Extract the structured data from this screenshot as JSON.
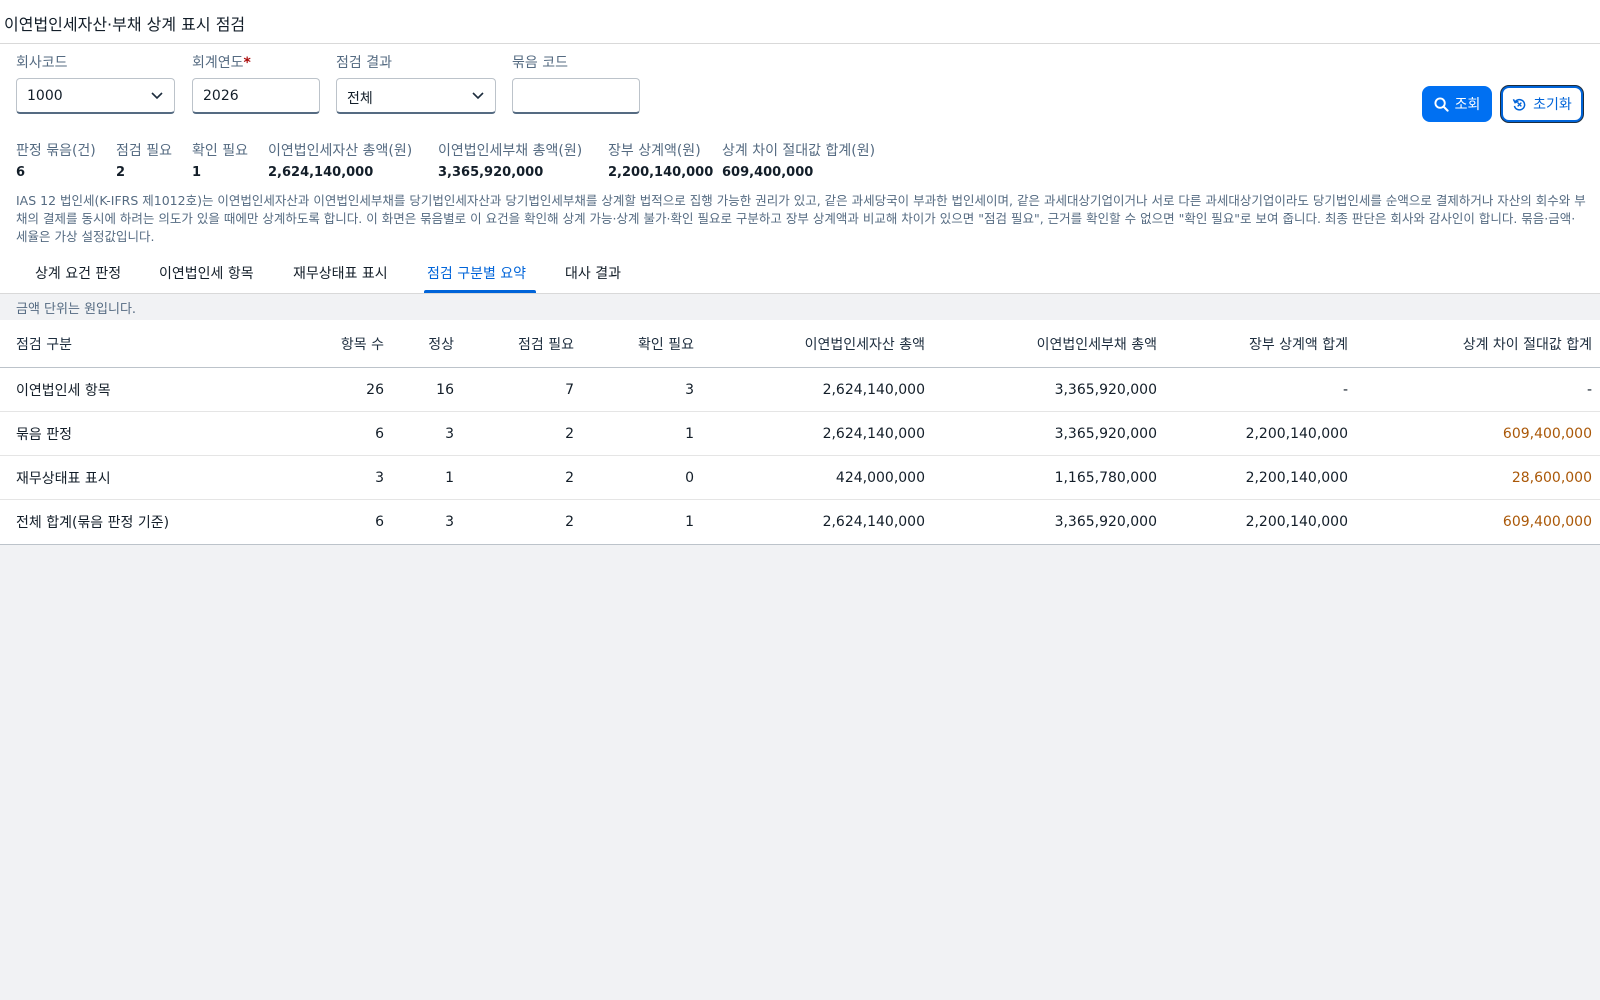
{
  "page": {
    "title": "이연법인세자산·부채 상계 표시 점검"
  },
  "filters": {
    "company_code": {
      "label": "회사코드",
      "value": "1000"
    },
    "fiscal_year": {
      "label": "회계연도",
      "required_mark": "*",
      "value": "2026"
    },
    "check_result": {
      "label": "점검 결과",
      "value": "전체"
    },
    "group_code": {
      "label": "묶음 코드",
      "value": ""
    }
  },
  "actions": {
    "search_label": "조회",
    "reset_label": "초기화"
  },
  "kpis": [
    {
      "label": "판정 묶음(건)",
      "value": "6"
    },
    {
      "label": "점검 필요",
      "value": "2"
    },
    {
      "label": "확인 필요",
      "value": "1"
    },
    {
      "label": "이연법인세자산 총액(원)",
      "value": "2,624,140,000"
    },
    {
      "label": "이연법인세부채 총액(원)",
      "value": "3,365,920,000"
    },
    {
      "label": "장부 상계액(원)",
      "value": "2,200,140,000"
    },
    {
      "label": "상계 차이 절대값 합계(원)",
      "value": "609,400,000"
    }
  ],
  "note": "IAS 12 법인세(K-IFRS 제1012호)는 이연법인세자산과 이연법인세부채를 당기법인세자산과 당기법인세부채를 상계할 법적으로 집행 가능한 권리가 있고, 같은 과세당국이 부과한 법인세이며, 같은 과세대상기업이거나 서로 다른 과세대상기업이라도 당기법인세를 순액으로 결제하거나 자산의 회수와 부채의 결제를 동시에 하려는 의도가 있을 때에만 상계하도록 합니다. 이 화면은 묶음별로 이 요건을 확인해 상계 가능·상계 불가·확인 필요로 구분하고 장부 상계액과 비교해 차이가 있으면 \"점검 필요\", 근거를 확인할 수 없으면 \"확인 필요\"로 보여 줍니다. 최종 판단은 회사와 감사인이 합니다. 묶음·금액·세율은 가상 설정값입니다.",
  "tabs": [
    {
      "label": "상계 요건 판정",
      "active": false
    },
    {
      "label": "이연법인세 항목",
      "active": false
    },
    {
      "label": "재무상태표 표시",
      "active": false
    },
    {
      "label": "점검 구분별 요약",
      "active": true
    },
    {
      "label": "대사 결과",
      "active": false
    }
  ],
  "unit_note": "금액 단위는 원입니다.",
  "table": {
    "columns": [
      "점검 구분",
      "항목 수",
      "정상",
      "점검 필요",
      "확인 필요",
      "이연법인세자산 총액",
      "이연법인세부채 총액",
      "장부 상계액 합계",
      "상계 차이 절대값 합계"
    ],
    "rows": [
      [
        "이연법인세 항목",
        "26",
        "16",
        "7",
        "3",
        "2,624,140,000",
        "3,365,920,000",
        "-",
        "-"
      ],
      [
        "묶음 판정",
        "6",
        "3",
        "2",
        "1",
        "2,624,140,000",
        "3,365,920,000",
        "2,200,140,000",
        "609,400,000"
      ],
      [
        "재무상태표 표시",
        "3",
        "1",
        "2",
        "0",
        "424,000,000",
        "1,165,780,000",
        "2,200,140,000",
        "28,600,000"
      ],
      [
        "전체 합계(묶음 판정 기준)",
        "6",
        "3",
        "2",
        "1",
        "2,624,140,000",
        "3,365,920,000",
        "2,200,140,000",
        "609,400,000"
      ]
    ]
  },
  "colors": {
    "accent": "#0064d9",
    "primary_button": "#0070f2",
    "diff_highlight": "#aa5808"
  }
}
